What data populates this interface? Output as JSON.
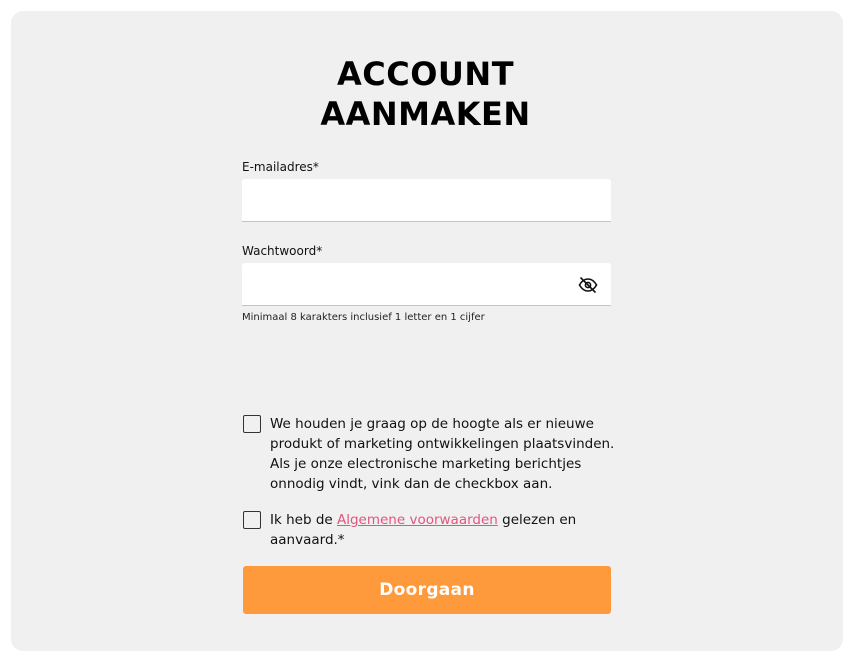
{
  "form": {
    "title_line1": "ACCOUNT",
    "title_line2": "AANMAKEN",
    "email_label": "E-mailadres*",
    "email_value": "",
    "password_label": "Wachtwoord*",
    "password_value": "",
    "password_hint": "Minimaal 8 karakters inclusief 1 letter en 1 cijfer",
    "password_toggle_icon": "eye-off-icon",
    "marketing_checked": false,
    "marketing_text": "We houden je graag op de hoogte als er nieuwe produkt of marketing ontwikkelingen plaatsvinden. Als je onze electronische marketing berichtjes onnodig vindt, vink dan de checkbox aan.",
    "terms_checked": false,
    "terms_prefix": "Ik heb de ",
    "terms_link": "Algemene voorwaarden",
    "terms_suffix": " gelezen en aanvaard.*",
    "submit_label": "Doorgaan"
  },
  "colors": {
    "panel_background": "#f0f0f0",
    "button": "#ff9a3c",
    "link": "#e0567f"
  }
}
